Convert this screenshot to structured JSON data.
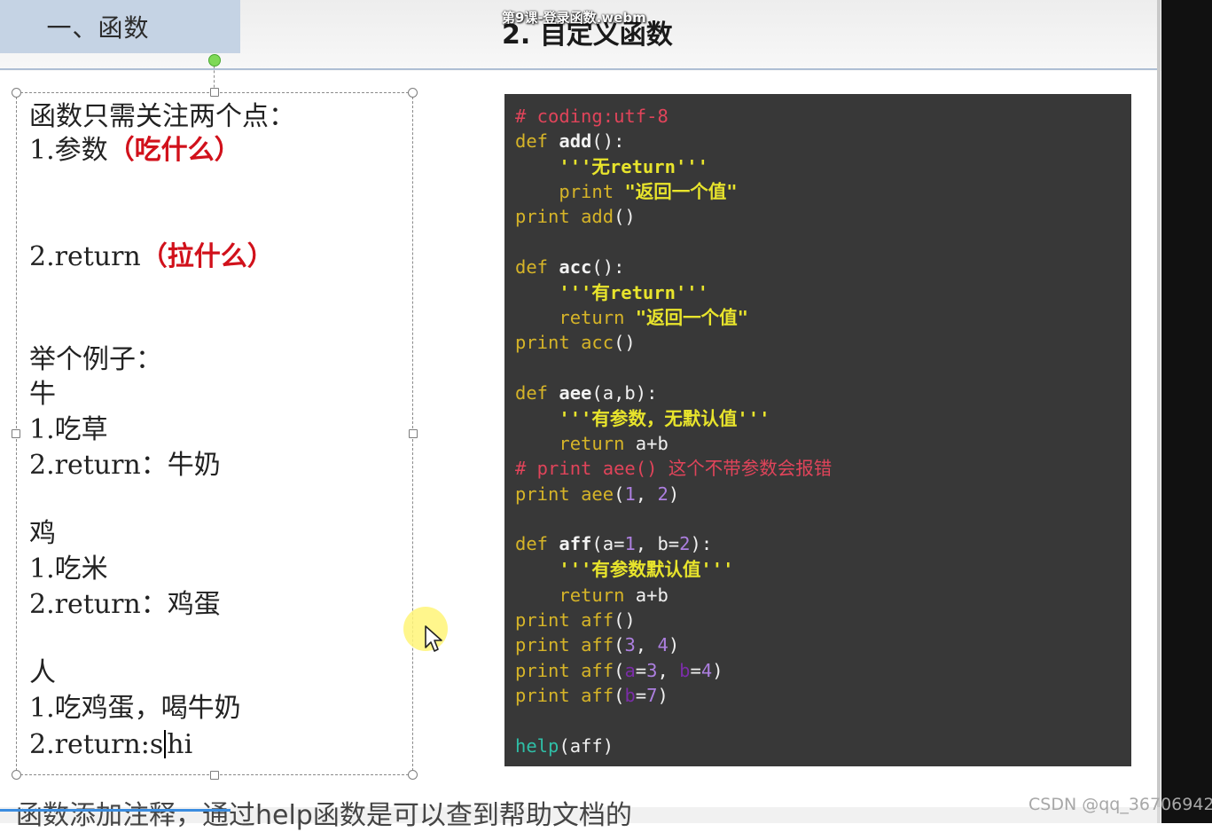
{
  "header": {
    "section_tab": "一、函数",
    "slide_title": "2. 自定义函数",
    "video_title": "第9课-登录函数.webm"
  },
  "textbox": {
    "lines": [
      "函数只需关注两个点：",
      "1.参数",
      "（吃什么）",
      "2.return",
      "（拉什么）",
      "举个例子：",
      "牛",
      "1.吃草",
      "2.return：牛奶",
      "鸡",
      "1.吃米",
      "2.return：鸡蛋",
      "人",
      "1.吃鸡蛋，喝牛奶",
      "2.return:s",
      "hi"
    ]
  },
  "code": {
    "tokens": [
      "# coding:utf-8",
      "def",
      "add",
      "():",
      "'''无return'''",
      "print",
      "\"返回一个值\"",
      "print",
      "add",
      "()",
      "def",
      "acc",
      "():",
      "'''有return'''",
      "return",
      "\"返回一个值\"",
      "print",
      "acc",
      "()",
      "def",
      "aee",
      "(a,b):",
      "'''有参数，无默认值'''",
      "return",
      "a+b",
      "# print aee() 这个不带参数会报错",
      "print",
      "aee",
      "(",
      "1",
      ", ",
      "2",
      ")",
      "def",
      "aff",
      "(a=",
      "1",
      ", b=",
      "2",
      "):",
      "'''有参数默认值'''",
      "return",
      "a+b",
      "print",
      "aff",
      "()",
      "print",
      "aff",
      "(",
      "3",
      ", ",
      "4",
      ")",
      "print",
      "aff",
      "(",
      "a",
      "=",
      "3",
      ", ",
      "b",
      "=",
      "4",
      ")",
      "print",
      "aff",
      "(",
      "b",
      "=",
      "7",
      ")",
      "help",
      "(aff)"
    ]
  },
  "footer": {
    "text": "函数添加注释，通过help函数是可以查到帮助文档的",
    "watermark": "CSDN @qq_36706942"
  },
  "colors": {
    "code_bg": "#383838",
    "comment": "#e0445a",
    "keyword": "#d6b428",
    "string": "#e8e42c",
    "number": "#ad7fe0",
    "help": "#2fbfa7",
    "emphasis_red": "#d1111b",
    "tab_bg": "#c5d3e4"
  },
  "icons": {
    "cursor": "mouse-pointer-icon"
  }
}
